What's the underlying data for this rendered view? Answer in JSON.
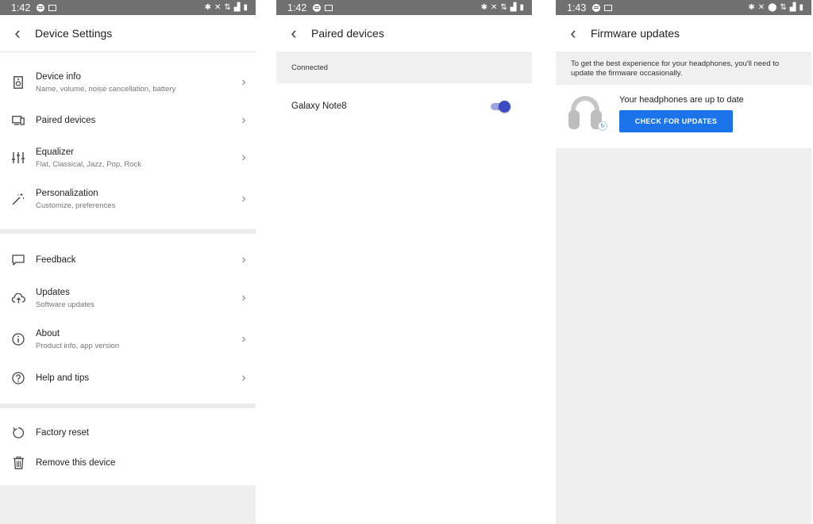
{
  "screen1": {
    "status": {
      "time": "1:42"
    },
    "title": "Device Settings",
    "group1": [
      {
        "label": "Device info",
        "sub": "Name, volume, noise cancellation, battery",
        "icon": "speaker-icon"
      },
      {
        "label": "Paired devices",
        "sub": "",
        "icon": "devices-icon"
      },
      {
        "label": "Equalizer",
        "sub": "Flat, Classical, Jazz, Pop, Rock",
        "icon": "equalizer-icon"
      },
      {
        "label": "Personalization",
        "sub": "Customize, preferences",
        "icon": "magic-wand-icon"
      }
    ],
    "group2": [
      {
        "label": "Feedback",
        "sub": "",
        "icon": "feedback-icon"
      },
      {
        "label": "Updates",
        "sub": "Software updates",
        "icon": "cloud-upload-icon"
      },
      {
        "label": "About",
        "sub": "Product info, app version",
        "icon": "info-icon"
      },
      {
        "label": "Help and tips",
        "sub": "",
        "icon": "help-icon"
      }
    ],
    "group3": [
      {
        "label": "Factory reset",
        "icon": "reset-icon"
      },
      {
        "label": "Remove this device",
        "icon": "trash-icon"
      }
    ]
  },
  "screen2": {
    "status": {
      "time": "1:42"
    },
    "title": "Paired devices",
    "section_header": "Connected",
    "device": {
      "name": "Galaxy Note8",
      "toggle_on": true
    }
  },
  "screen3": {
    "status": {
      "time": "1:43"
    },
    "title": "Firmware updates",
    "banner": "To get the best experience for your headphones, you'll need to update the firmware occasionally.",
    "status_text": "Your headphones are up to date",
    "button_label": "CHECK FOR UPDATES"
  },
  "colors": {
    "accent": "#1a73e8",
    "toggle": "#3c4bc4",
    "statusbar": "#707070"
  }
}
